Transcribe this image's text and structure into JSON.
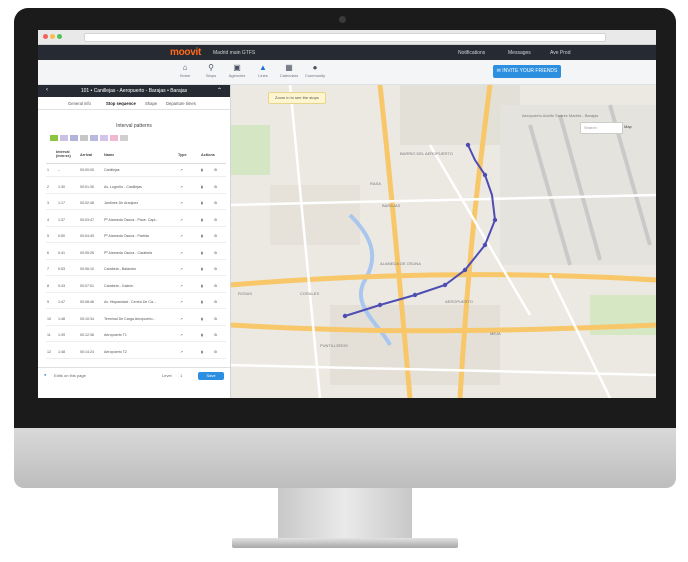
{
  "app": {
    "logo": "moovit",
    "agency": "Madrid main GTFS",
    "topbar": {
      "notifications": "Notifications",
      "messages": "Messages",
      "user": "Ave Prod"
    },
    "nav": [
      {
        "label": "Home",
        "icon": "home-icon"
      },
      {
        "label": "Stops",
        "icon": "pin-icon"
      },
      {
        "label": "Agencies",
        "icon": "bus-icon"
      },
      {
        "label": "Lines",
        "icon": "road-icon"
      },
      {
        "label": "Calendars",
        "icon": "calendar-icon"
      },
      {
        "label": "Community",
        "icon": "chat-icon"
      }
    ],
    "invite_label": "INVITE YOUR FRIENDS"
  },
  "panel": {
    "title": "101 • Canillejas - Aeropuerto - Barajas • Barajas",
    "tabs": [
      "General info",
      "Stop sequence",
      "Shape",
      "Departure times"
    ],
    "active_tab": "Stop sequence",
    "section_title": "Interval patterns",
    "swatches": [
      "#8cc63f",
      "#c9c1e6",
      "#b3b3d9",
      "#c7c7c7",
      "#b9b9e0",
      "#d3c5e9",
      "#f3b7d1",
      "#cfcfcf"
    ],
    "columns": [
      "Interval (mm:ss)",
      "Arrival",
      "Name",
      "Type",
      "Actions"
    ],
    "rows": [
      {
        "n": "1",
        "interval": "–",
        "arrival": "00:00:00",
        "name": "Canillejas"
      },
      {
        "n": "2",
        "interval": "1:30",
        "arrival": "00:01:30",
        "name": "Av. Logroño - Canillejas"
      },
      {
        "n": "3",
        "interval": "1:17",
        "arrival": "00:02:48",
        "name": "Jardines De Aranjuez"
      },
      {
        "n": "4",
        "interval": "1:37",
        "arrival": "00:03:47",
        "name": "Pº Alameda Osuna - Paue. Capi..."
      },
      {
        "n": "5",
        "interval": "0:50",
        "arrival": "00:04:49",
        "name": "Pº Alameda Osuna - Partida"
      },
      {
        "n": "6",
        "interval": "0:41",
        "arrival": "00:05:26",
        "name": "Pº Alameda Osuna - Carabela"
      },
      {
        "n": "7",
        "interval": "0:53",
        "arrival": "00:06:10",
        "name": "Carabela - Balandro"
      },
      {
        "n": "8",
        "interval": "0:43",
        "arrival": "00:07:01",
        "name": "Carabela - Galeón"
      },
      {
        "n": "9",
        "interval": "1:47",
        "arrival": "00:08:46",
        "name": "Av. Hispanidad - Centro De Ca..."
      },
      {
        "n": "10",
        "interval": "1:48",
        "arrival": "00:10:34",
        "name": "Terminal De Carga Aeropuerto..."
      },
      {
        "n": "11",
        "interval": "1:39",
        "arrival": "00:12:36",
        "name": "Aeropuerto T1"
      },
      {
        "n": "12",
        "interval": "1:48",
        "arrival": "00:14:24",
        "name": "Aeropuerto T2"
      }
    ],
    "type_glyph": "↗",
    "footer": {
      "edits_label": "Edits on this page",
      "level_label": "Level",
      "level_value": "1",
      "save_label": "Save"
    }
  },
  "map": {
    "hint": "Zoom in to see the stops",
    "search_placeholder": "Search",
    "map_type": "Map",
    "labels": [
      {
        "text": "Aeropuerto Adolfo Suárez Madrid - Barajas"
      },
      {
        "text": "BARRIO DEL AEROPUERTO"
      },
      {
        "text": "BARAJAS"
      },
      {
        "text": "ALAMEDA DE OSUNA"
      },
      {
        "text": "RASA"
      },
      {
        "text": "CORALES"
      },
      {
        "text": "ROSAS"
      },
      {
        "text": "PUNTILLEROS"
      },
      {
        "text": "MEJA"
      },
      {
        "text": "AEROPUERTO"
      }
    ],
    "route_color": "#4d4db3"
  }
}
